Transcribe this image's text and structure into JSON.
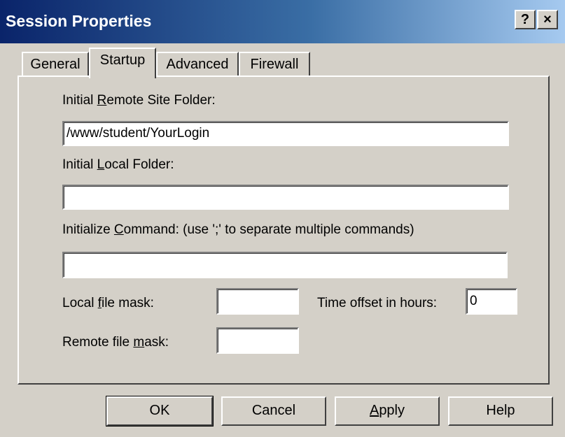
{
  "window": {
    "title": "Session Properties",
    "help_button": "?",
    "close_button": "×"
  },
  "tabs": [
    {
      "label": "General",
      "active": false
    },
    {
      "label": "Startup",
      "active": true
    },
    {
      "label": "Advanced",
      "active": false
    },
    {
      "label": "Firewall",
      "active": false
    }
  ],
  "startup": {
    "remote_folder_label_pre": "Initial ",
    "remote_folder_label_key": "R",
    "remote_folder_label_post": "emote Site Folder:",
    "remote_folder_value": "/www/student/YourLogin",
    "local_folder_label_pre": "Initial ",
    "local_folder_label_key": "L",
    "local_folder_label_post": "ocal Folder:",
    "local_folder_value": "",
    "init_command_label_pre": "Initialize ",
    "init_command_label_key": "C",
    "init_command_label_post": "ommand: (use ';' to separate multiple commands)",
    "init_command_value": "",
    "local_mask_label_pre": "Local ",
    "local_mask_label_key": "f",
    "local_mask_label_post": "ile mask:",
    "local_mask_value": "",
    "remote_mask_label_pre": "Remote file ",
    "remote_mask_label_key": "m",
    "remote_mask_label_post": "ask:",
    "remote_mask_value": "",
    "time_offset_label": "Time offset in hours:",
    "time_offset_value": "0"
  },
  "buttons": {
    "ok": "OK",
    "cancel": "Cancel",
    "apply_key": "A",
    "apply_rest": "pply",
    "help": "Help"
  }
}
